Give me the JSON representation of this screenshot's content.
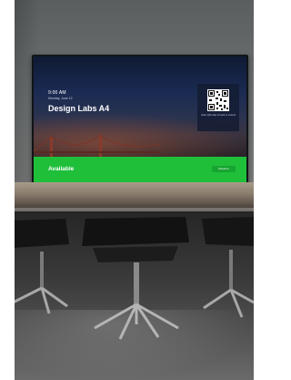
{
  "screen": {
    "time": "9:00 AM",
    "date": "Monday, June 12",
    "room_name": "Design Labs A4",
    "qr_caption": "Scan QR code to book or extend",
    "status": "Available",
    "button_label": "Reserve"
  },
  "colors": {
    "status_green": "#1fbf3a",
    "screen_bg": "#1a2a52",
    "wall": "#6b6f70"
  }
}
